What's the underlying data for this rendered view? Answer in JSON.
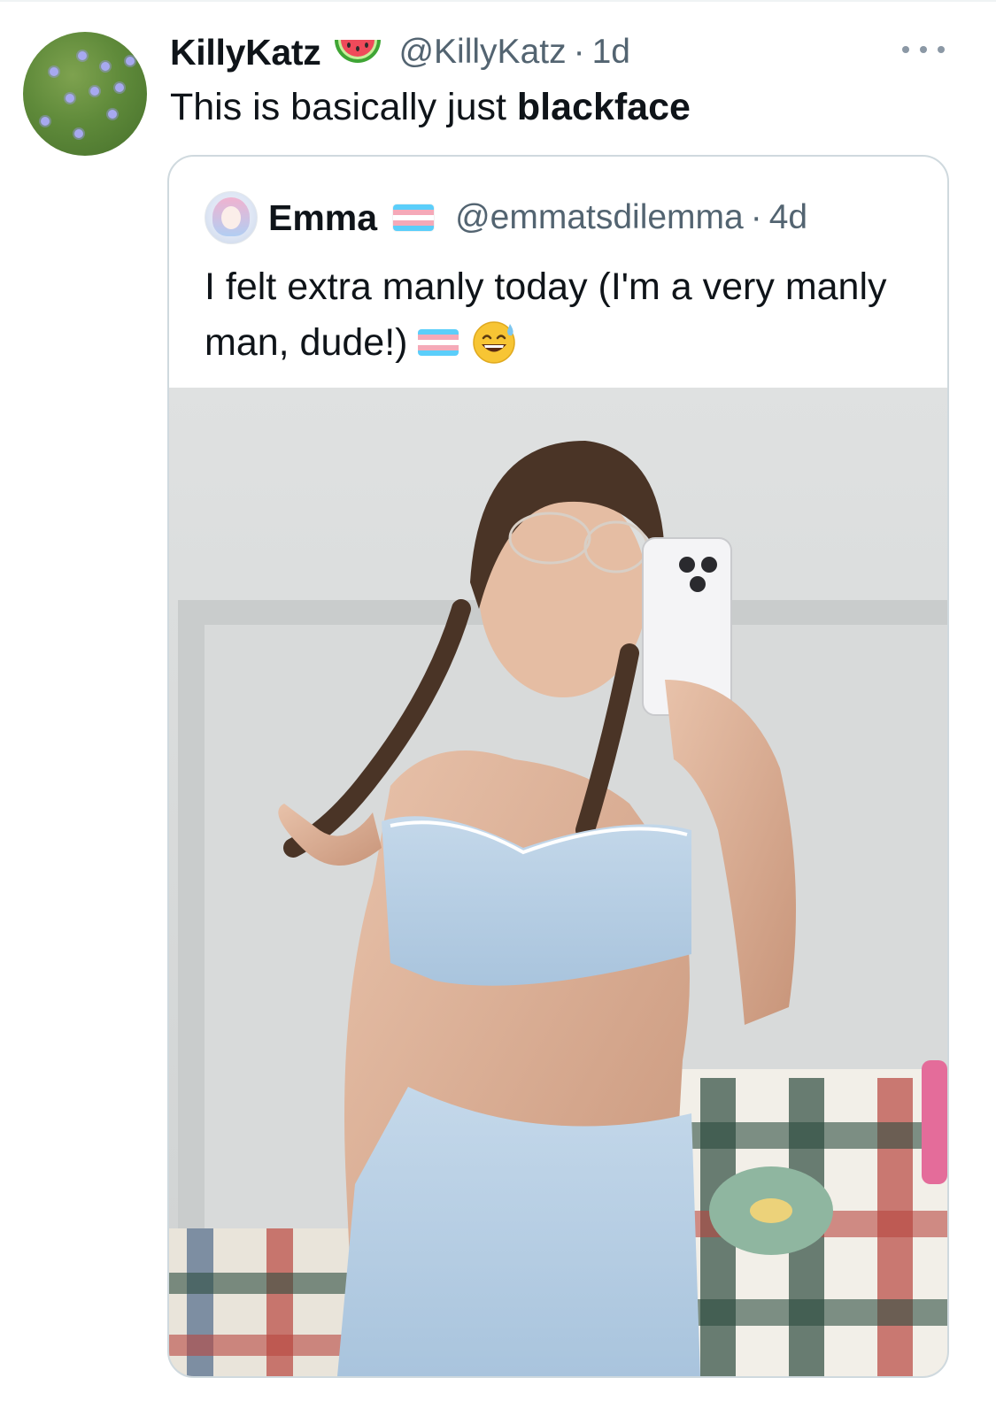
{
  "reply": {
    "display_name": "KillyKatz",
    "name_emoji": "watermelon-icon",
    "handle": "@KillyKatz",
    "separator": "·",
    "time": "1d",
    "text_prefix": "This is basically just ",
    "text_bold": "blackface",
    "avatar": "avatar-grass-flowers",
    "more_icon": "more-horizontal-icon"
  },
  "quote": {
    "display_name": "Emma",
    "name_emoji": "transgender-flag-icon",
    "handle": "@emmatsdilemma",
    "separator": "·",
    "time": "4d",
    "text": "I felt extra manly today (I'm a very manly man, dude!)",
    "text_emojis": [
      "transgender-flag-icon",
      "grinning-face-with-sweat-icon"
    ],
    "avatar": "avatar-anime-character",
    "media": "attached-photo"
  },
  "colors": {
    "text_primary": "#0f1419",
    "text_secondary": "#536471",
    "card_border": "#cfd9de",
    "flag_blue": "#5bcefa",
    "flag_pink": "#f5a9b8",
    "flag_white": "#ffffff"
  }
}
